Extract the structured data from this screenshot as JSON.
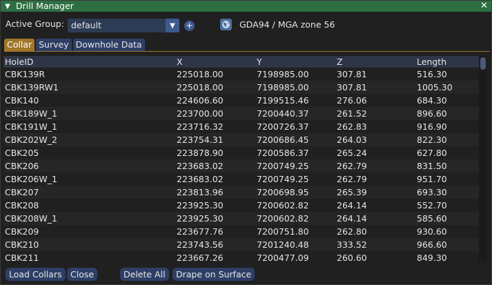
{
  "window": {
    "title": "Drill Manager",
    "collapse_glyph": "▼",
    "close_glyph": "✕"
  },
  "toolbar": {
    "group_label": "Active Group:",
    "group_value": "default",
    "dropdown_arrow": "▼",
    "add_glyph": "+",
    "crs": "GDA94 / MGA zone 56"
  },
  "tabs": [
    "Collar",
    "Survey",
    "Downhole Data"
  ],
  "table": {
    "columns": [
      "HoleID",
      "X",
      "Y",
      "Z",
      "Length"
    ],
    "rows": [
      [
        "CBK139R",
        "225018.00",
        "7198985.00",
        "307.81",
        "516.30"
      ],
      [
        "CBK139RW1",
        "225018.00",
        "7198985.00",
        "307.81",
        "1005.30"
      ],
      [
        "CBK140",
        "224606.60",
        "7199515.46",
        "276.06",
        "684.30"
      ],
      [
        "CBK189W_1",
        "223700.00",
        "7200440.37",
        "261.52",
        "896.60"
      ],
      [
        "CBK191W_1",
        "223716.32",
        "7200726.37",
        "262.83",
        "916.90"
      ],
      [
        "CBK202W_2",
        "223754.31",
        "7200686.45",
        "264.03",
        "822.30"
      ],
      [
        "CBK205",
        "223878.90",
        "7200586.37",
        "265.24",
        "627.80"
      ],
      [
        "CBK206",
        "223683.02",
        "7200749.25",
        "262.79",
        "831.50"
      ],
      [
        "CBK206W_1",
        "223683.02",
        "7200749.25",
        "262.79",
        "951.70"
      ],
      [
        "CBK207",
        "223813.96",
        "7200698.95",
        "265.39",
        "693.30"
      ],
      [
        "CBK208",
        "223925.30",
        "7200602.82",
        "264.14",
        "552.70"
      ],
      [
        "CBK208W_1",
        "223925.30",
        "7200602.82",
        "264.14",
        "585.60"
      ],
      [
        "CBK209",
        "223677.76",
        "7200751.80",
        "262.80",
        "930.60"
      ],
      [
        "CBK210",
        "223743.56",
        "7201240.48",
        "333.52",
        "966.60"
      ],
      [
        "CBK211",
        "223667.26",
        "7200477.09",
        "260.60",
        "849.30"
      ]
    ]
  },
  "buttons": {
    "load": "Load Collars",
    "close": "Close",
    "delete_all": "Delete All",
    "drape": "Drape on Surface"
  },
  "colors": {
    "titlebar": "#2e6f42",
    "active_tab": "#a0772a",
    "button": "#2e3f66"
  }
}
